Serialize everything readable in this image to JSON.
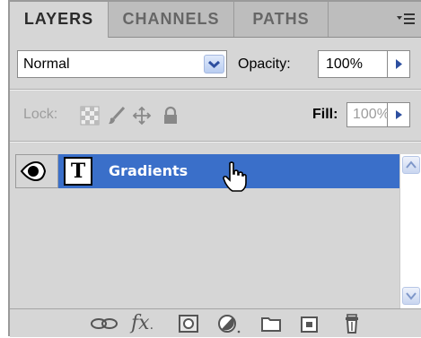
{
  "tabs": [
    {
      "label": "LAYERS",
      "active": true
    },
    {
      "label": "CHANNELS",
      "active": false
    },
    {
      "label": "PATHS",
      "active": false
    }
  ],
  "panel_menu_icon": "panel-menu-icon",
  "blend_mode": {
    "value": "Normal"
  },
  "opacity": {
    "label": "Opacity:",
    "value": "100%"
  },
  "lock": {
    "label": "Lock:",
    "icons": [
      "lock-transparent-icon",
      "lock-paint-icon",
      "lock-move-icon",
      "lock-all-icon"
    ]
  },
  "fill": {
    "label": "Fill:",
    "value": "100%"
  },
  "layers": [
    {
      "name": "Gradients",
      "type_glyph": "T",
      "visible": true,
      "selected": true
    }
  ],
  "bottom_icons": [
    "link-layers-icon",
    "fx-icon",
    "add-mask-icon",
    "adjustment-layer-icon",
    "new-group-icon",
    "new-layer-icon",
    "delete-layer-icon"
  ],
  "fx_text": "fx",
  "colors": {
    "selected_layer": "#3a6fc9",
    "panel_bg": "#d6d6d6",
    "tab_bg": "#bdbdbd"
  }
}
